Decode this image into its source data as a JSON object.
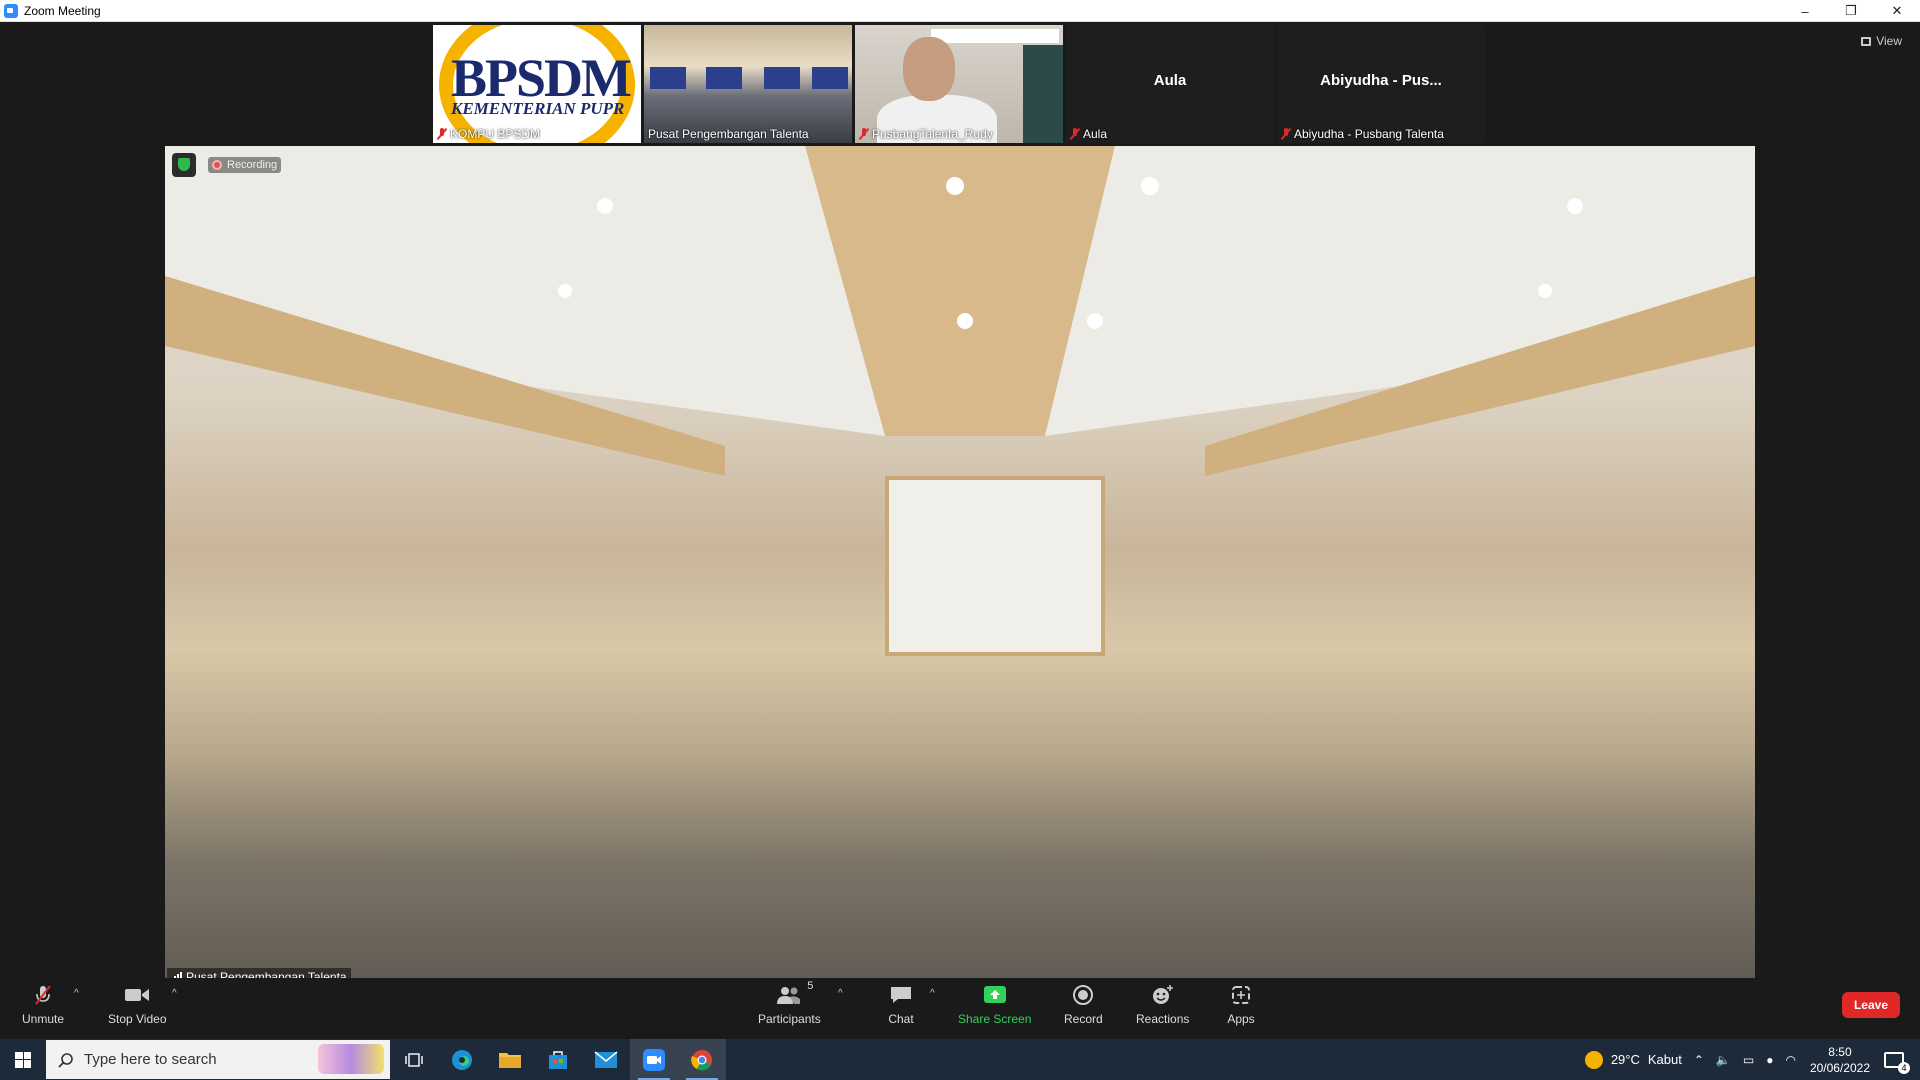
{
  "window": {
    "title": "Zoom Meeting",
    "minimize": "–",
    "restore": "❐",
    "close": "✕"
  },
  "view_button": {
    "label": "View"
  },
  "thumbnails": [
    {
      "name": "KOMPU BPSDM",
      "logo_line1": "BPSDM",
      "logo_line2": "KEMENTERIAN PUPR"
    },
    {
      "name": "Pusat Pengembangan Talenta"
    },
    {
      "name": "PusbangTalenta_Rudy"
    },
    {
      "name": "Aula",
      "display_name": "Aula"
    },
    {
      "name": "Abiyudha - Pusbang Talenta",
      "display_name": "Abiyudha - Pus..."
    }
  ],
  "main_video": {
    "recording_label": "Recording",
    "speaker_name": "Pusat Pengembangan Talenta"
  },
  "toolbar": {
    "unmute": "Unmute",
    "stop_video": "Stop Video",
    "participants": "Participants",
    "participants_count": "5",
    "chat": "Chat",
    "share_screen": "Share Screen",
    "record": "Record",
    "reactions": "Reactions",
    "apps": "Apps",
    "leave": "Leave"
  },
  "taskbar": {
    "search_placeholder": "Type here to search",
    "weather_temp": "29°C",
    "weather_desc": "Kabut",
    "time": "8:50",
    "date": "20/06/2022",
    "notification_count": "4"
  },
  "colors": {
    "accent": "#2d8cff",
    "leave": "#e02828",
    "share": "#2fd35a",
    "mute": "#e02828"
  }
}
